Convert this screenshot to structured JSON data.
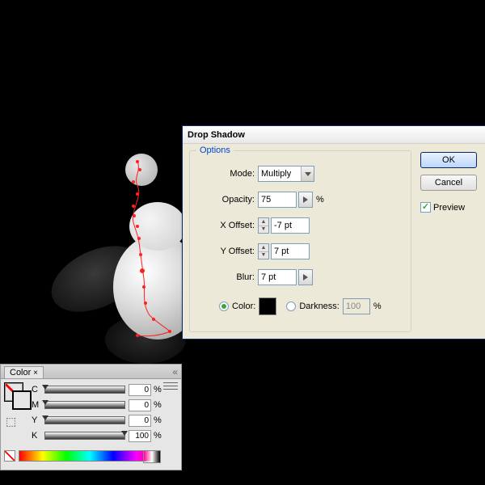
{
  "dialog": {
    "title": "Drop Shadow",
    "options_label": "Options",
    "mode_label": "Mode:",
    "mode_value": "Multiply",
    "opacity_label": "Opacity:",
    "opacity_value": "75",
    "xoffset_label": "X Offset:",
    "xoffset_value": "-7 pt",
    "yoffset_label": "Y Offset:",
    "yoffset_value": "7 pt",
    "blur_label": "Blur:",
    "blur_value": "7 pt",
    "color_label": "Color:",
    "darkness_label": "Darkness:",
    "darkness_value": "100",
    "percent": "%",
    "ok": "OK",
    "cancel": "Cancel",
    "preview": "Preview"
  },
  "color_panel": {
    "tab": "Color",
    "channels": [
      {
        "ch": "C",
        "val": "0"
      },
      {
        "ch": "M",
        "val": "0"
      },
      {
        "ch": "Y",
        "val": "0"
      },
      {
        "ch": "K",
        "val": "100"
      }
    ],
    "percent": "%"
  }
}
